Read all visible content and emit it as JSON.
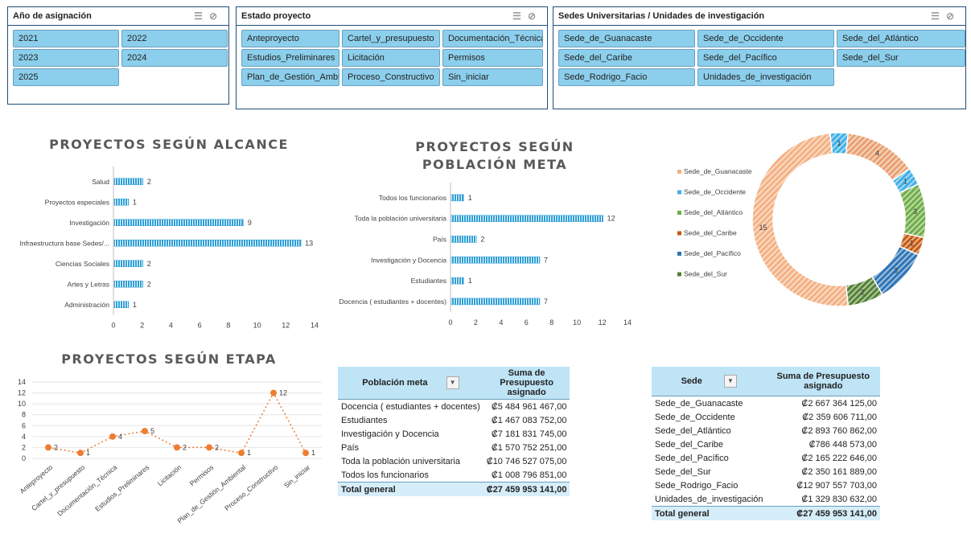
{
  "slicers": {
    "year": {
      "title": "Año de asignación",
      "items": [
        "2021",
        "2022",
        "2023",
        "2024",
        "2025"
      ]
    },
    "estado": {
      "title": "Estado proyecto",
      "items": [
        "Anteproyecto",
        "Cartel_y_presupuesto",
        "Documentación_Técnica",
        "Estudios_Preliminares",
        "Licitación",
        "Permisos",
        "Plan_de_Gestión_Ambi...",
        "Proceso_Constructivo",
        "Sin_iniciar"
      ]
    },
    "sedes": {
      "title": "Sedes Universitarias / Unidades de investigación",
      "items": [
        "Sede_de_Guanacaste",
        "Sede_de_Occidente",
        "Sede_del_Atlántico",
        "Sede_del_Caribe",
        "Sede_del_Pacífico",
        "Sede_del_Sur",
        "Sede_Rodrigo_Facio",
        "Unidades_de_investigación"
      ]
    }
  },
  "chart_data": [
    {
      "id": "alcance",
      "type": "bar",
      "orientation": "horizontal",
      "title": "PROYECTOS SEGÚN ALCANCE",
      "categories": [
        "Salud",
        "Proyectos especiales",
        "Investigación",
        "Infraestructura base Sedes/...",
        "Ciencias Sociales",
        "Artes y Letras",
        "Administración"
      ],
      "values": [
        2,
        1,
        9,
        13,
        2,
        2,
        1
      ],
      "xlim": [
        0,
        14
      ],
      "xticks": [
        "0",
        "2",
        "4",
        "6",
        "8",
        "10",
        "12",
        "14"
      ],
      "color": "#2e9fd6"
    },
    {
      "id": "poblacion",
      "type": "bar",
      "orientation": "horizontal",
      "title": "PROYECTOS SEGÚN POBLACIÓN META",
      "categories": [
        "Todos los funcionarios",
        "Toda la población universitaria",
        "País",
        "Investigación y Docencia",
        "Estudiantes",
        "Docencia ( estudiantes + docentes)"
      ],
      "values": [
        1,
        12,
        2,
        7,
        1,
        7
      ],
      "xlim": [
        0,
        14
      ],
      "xticks": [
        "0",
        "2",
        "4",
        "6",
        "8",
        "10",
        "12",
        "14"
      ],
      "color": "#2e9fd6"
    },
    {
      "id": "sedes-donut",
      "type": "pie",
      "donut": true,
      "legend_position": "left",
      "labels": [
        "Sede_de_Guanacaste",
        "Sede_de_Occidente",
        "Sede_del_Atlántico",
        "Sede_del_Caribe",
        "Sede_del_Pacífico",
        "Sede_del_Sur"
      ],
      "legend_colors": [
        "#f4b183",
        "#3eb0e6",
        "#70ad47",
        "#c55a11",
        "#2e75b6",
        "#548235"
      ],
      "slices": [
        {
          "value": 1,
          "color": "#3eb0e6"
        },
        {
          "value": 4,
          "color": "#e9a070"
        },
        {
          "value": 1,
          "color": "#3eb0e6"
        },
        {
          "value": 3,
          "color": "#70ad47"
        },
        {
          "value": 1,
          "color": "#c55a11"
        },
        {
          "value": 3,
          "color": "#2e75b6"
        },
        {
          "value": 2,
          "color": "#548235"
        },
        {
          "value": 15,
          "color": "#f4b183"
        }
      ]
    },
    {
      "id": "etapa",
      "type": "line",
      "title": "PROYECTOS SEGÚN ETAPA",
      "categories": [
        "Anteproyecto",
        "Cartel_y_presupuesto",
        "Documentación_Técnica",
        "Estudios_Preliminares",
        "Licitación",
        "Permisos",
        "Plan_de_Gestión_Ambiental",
        "Proceso_Constructivo",
        "Sin_iniciar"
      ],
      "values": [
        2,
        1,
        4,
        5,
        2,
        2,
        1,
        12,
        1
      ],
      "ylim": [
        0,
        14
      ],
      "yticks": [
        "0",
        "2",
        "4",
        "6",
        "8",
        "10",
        "12",
        "14"
      ],
      "color": "#ed7d31"
    }
  ],
  "table_poblacion": {
    "header": [
      "Población meta",
      "Suma de Presupuesto asignado"
    ],
    "dropdown": "▼",
    "rows": [
      [
        "Docencia ( estudiantes + docentes)",
        "₡5 484 961 467,00"
      ],
      [
        "Estudiantes",
        "₡1 467 083 752,00"
      ],
      [
        "Investigación y Docencia",
        "₡7 181 831 745,00"
      ],
      [
        "País",
        "₡1 570 752 251,00"
      ],
      [
        "Toda la población universitaria",
        "₡10 746 527 075,00"
      ],
      [
        "Todos los funcionarios",
        "₡1 008 796 851,00"
      ]
    ],
    "total": [
      "Total general",
      "₡27 459 953 141,00"
    ]
  },
  "table_sede": {
    "header": [
      "Sede",
      "Suma de Presupuesto asignado"
    ],
    "dropdown": "▼",
    "rows": [
      [
        "Sede_de_Guanacaste",
        "₡2 667 364 125,00"
      ],
      [
        "Sede_de_Occidente",
        "₡2 359 606 711,00"
      ],
      [
        "Sede_del_Atlántico",
        "₡2 893 760 862,00"
      ],
      [
        "Sede_del_Caribe",
        "₡786 448 573,00"
      ],
      [
        "Sede_del_Pacífico",
        "₡2 165 222 646,00"
      ],
      [
        "Sede_del_Sur",
        "₡2 350 161 889,00"
      ],
      [
        "Sede_Rodrigo_Facio",
        "₡12 907 557 703,00"
      ],
      [
        "Unidades_de_investigación",
        "₡1 329 830 632,00"
      ]
    ],
    "total": [
      "Total general",
      "₡27 459 953 141,00"
    ]
  },
  "icons": {
    "multiselect": "multi-select-icon",
    "clear_filter": "clear-filter-icon"
  }
}
